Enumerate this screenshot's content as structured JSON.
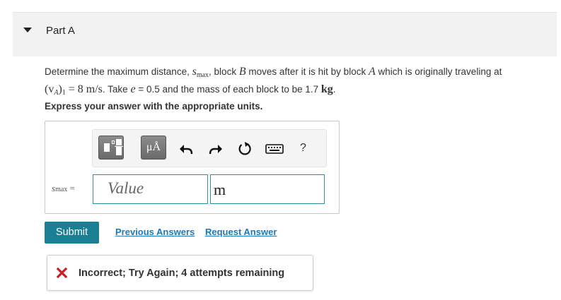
{
  "part": {
    "title": "Part A"
  },
  "question": {
    "text_1": "Determine the maximum distance,",
    "var_s": "s",
    "var_sub_max": "max",
    "text_2": ", block",
    "block_b": "B",
    "text_3": "moves after it is hit by block",
    "block_a": "A",
    "text_4": "which is originally traveling at",
    "va_lhs": "(v",
    "va_sub": "A",
    "va_rhs": ")",
    "va_sub1": "1",
    "va_eq": "= 8 m/s",
    "text_5": ". Take",
    "var_e": "e",
    "text_6": "= 0.5 and the mass of each block to be 1.7",
    "kg": "kg",
    "text_7": "."
  },
  "instruction": "Express your answer with the appropriate units.",
  "toolbar": {
    "units_label": "μÅ",
    "help": "?",
    "icons": [
      "templates-icon",
      "units-icon",
      "undo-icon",
      "redo-icon",
      "reset-icon",
      "keyboard-icon",
      "help-icon"
    ]
  },
  "answer": {
    "label_var": "s",
    "label_sub": "max",
    "label_eq": "=",
    "value_placeholder": "Value",
    "unit_value": "m"
  },
  "actions": {
    "submit_label": "Submit",
    "previous_answers": "Previous Answers",
    "request_answer": "Request Answer"
  },
  "feedback": {
    "text": "Incorrect; Try Again; 4 attempts remaining",
    "icon": "x-icon",
    "icon_color": "#cc1f1f"
  },
  "colors": {
    "accent": "#1a7f93",
    "link": "#1f77b4",
    "input_border": "#2a8f9c"
  }
}
